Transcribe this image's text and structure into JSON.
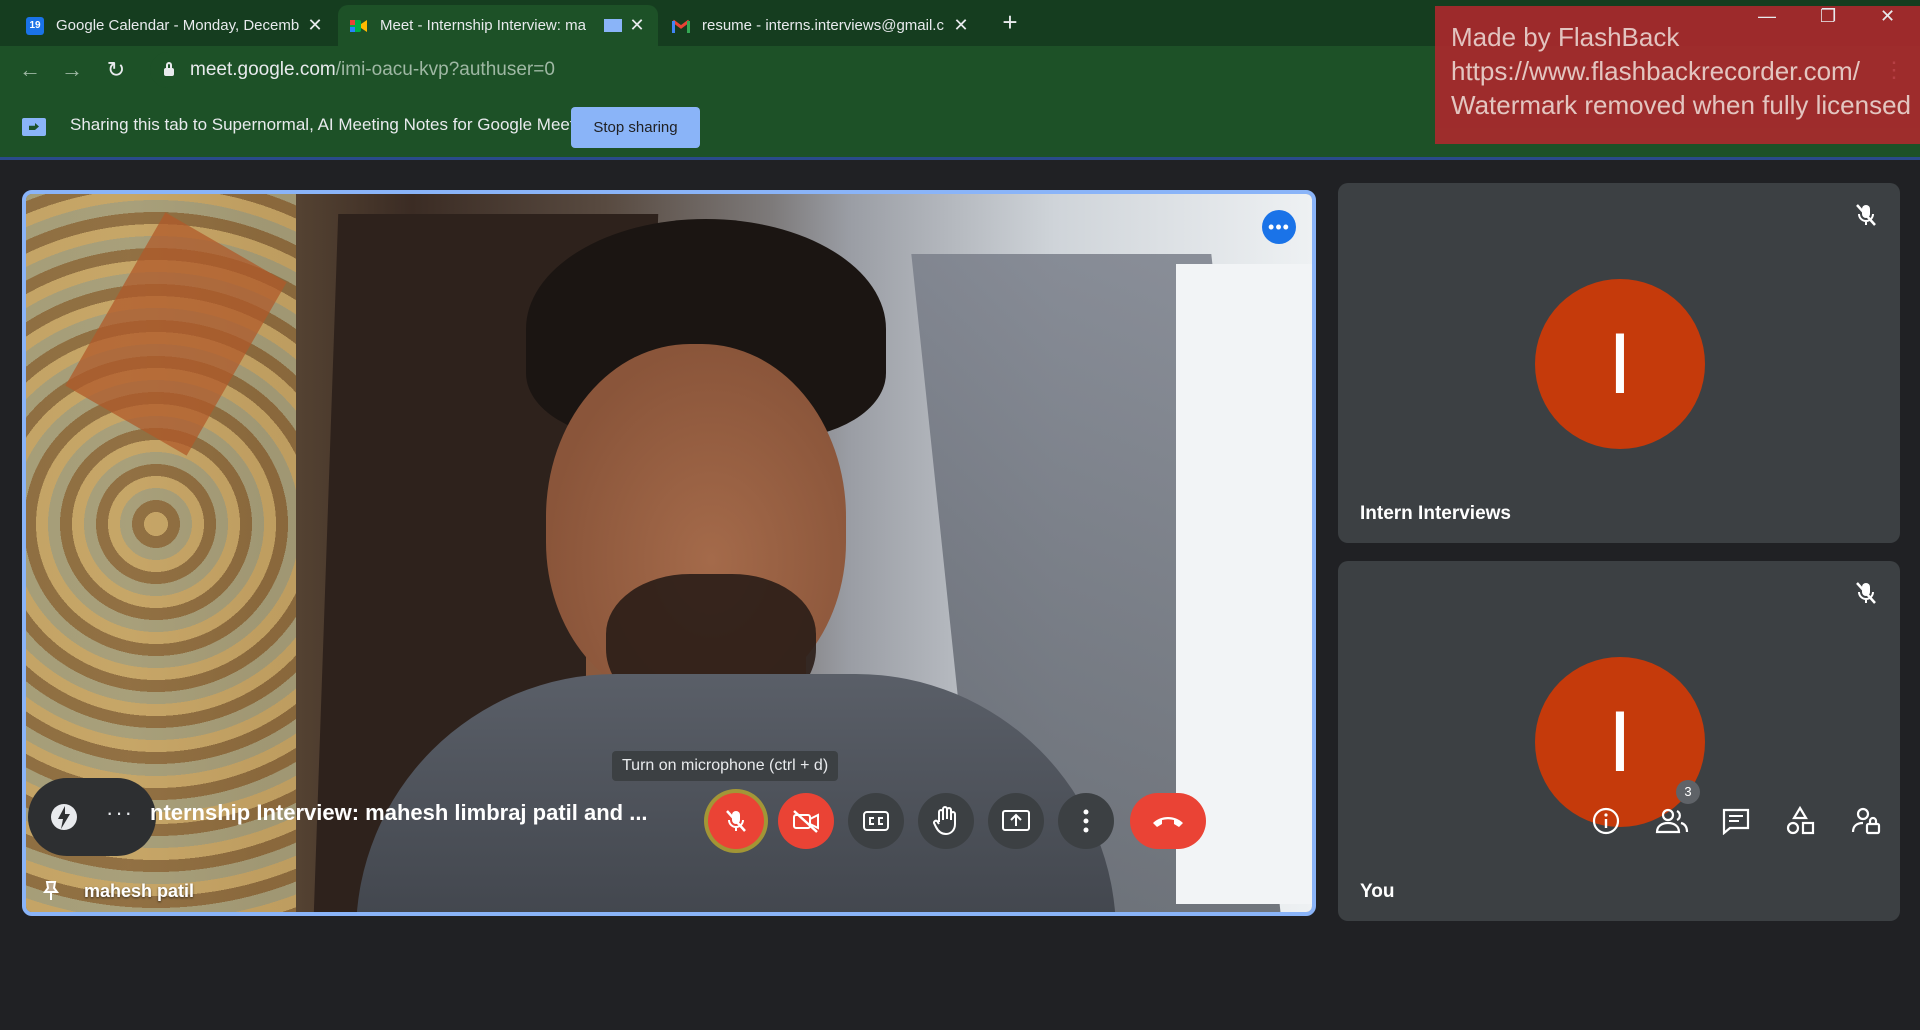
{
  "tabs": [
    {
      "title": "Google Calendar - Monday, Decemb",
      "favicon": "calendar-icon",
      "favicon_text": "19"
    },
    {
      "title": "Meet - Internship Interview: ma",
      "favicon": "meet-icon"
    },
    {
      "title": "resume - interns.interviews@gmail.c",
      "favicon": "gmail-icon"
    }
  ],
  "address": {
    "host": "meet.google.com",
    "path": "/imi-oacu-kvp?authuser=0"
  },
  "share_bar": {
    "text": "Sharing this tab to Supernormal, AI Meeting Notes for Google Meet",
    "stop_label": "Stop sharing"
  },
  "watermark": {
    "line1": "Made by FlashBack",
    "line2": "https://www.flashbackrecorder.com/",
    "line3": "Watermark removed when fully licensed"
  },
  "main_tile": {
    "name": "mahesh patil",
    "more_label": "•••"
  },
  "participants": [
    {
      "initial": "I",
      "name": "Intern Interviews",
      "muted": true
    },
    {
      "initial": "I",
      "name": "You",
      "muted": true
    }
  ],
  "bottom": {
    "meeting_title": "nternship Interview: mahesh limbraj patil and ...",
    "tooltip": "Turn on microphone (ctrl + d)",
    "people_count": "3",
    "addon_dots": "···"
  },
  "colors": {
    "avatar": "#c53a0b",
    "accent": "#8ab4f8",
    "danger": "#ea4335",
    "chrome_green": "#1d5127"
  }
}
